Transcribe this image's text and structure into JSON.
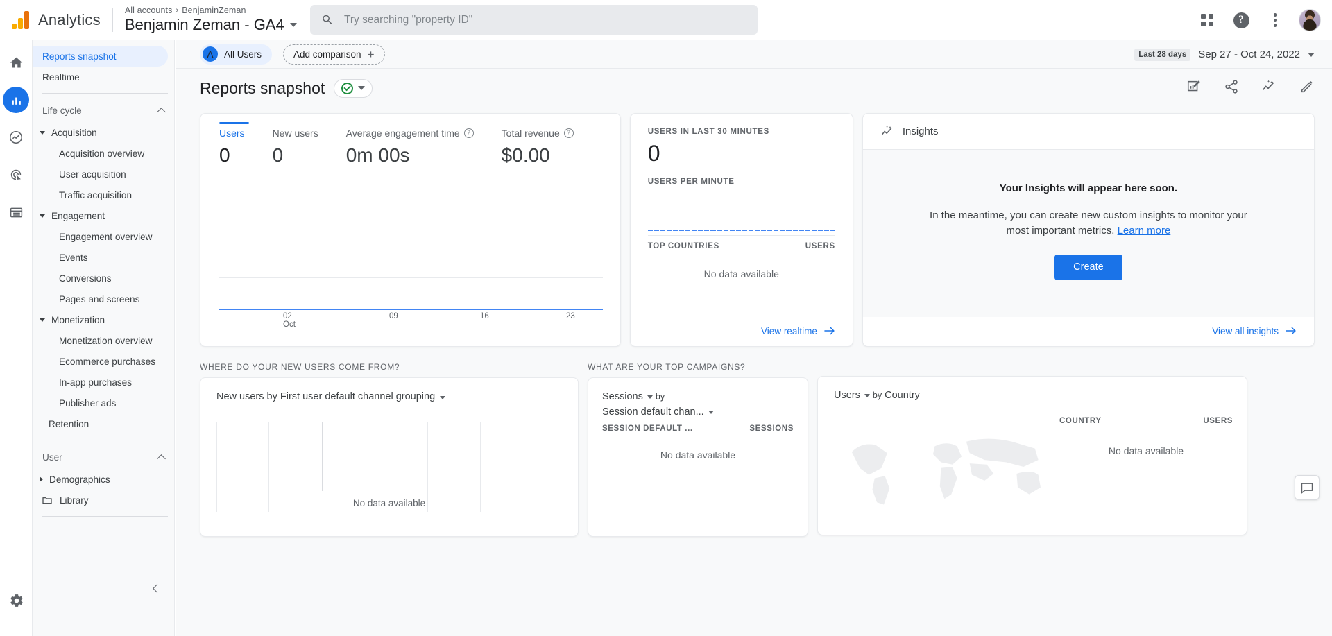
{
  "header": {
    "brand": "Analytics",
    "breadcrumb_root": "All accounts",
    "breadcrumb_sep": "›",
    "breadcrumb_account": "BenjaminZeman",
    "property_name": "Benjamin Zeman - GA4",
    "search_placeholder": "Try searching \"property ID\"",
    "search_value": "",
    "icons": {
      "search": "search-icon",
      "apps": "apps-grid-icon",
      "help": "help-icon",
      "more": "more-vert-icon",
      "avatar": "user-avatar"
    }
  },
  "rail": {
    "items": [
      {
        "name": "home",
        "icon": "home-icon",
        "active": false
      },
      {
        "name": "reports",
        "icon": "bar-chart-icon",
        "active": true
      },
      {
        "name": "explore",
        "icon": "explore-icon",
        "active": false
      },
      {
        "name": "advertising",
        "icon": "advertising-icon",
        "active": false
      },
      {
        "name": "configure",
        "icon": "list-icon",
        "active": false
      }
    ],
    "settings_icon": "gear-icon"
  },
  "sidebar": {
    "top_items": [
      {
        "label": "Reports snapshot",
        "active": true
      },
      {
        "label": "Realtime",
        "active": false
      }
    ],
    "groups": [
      {
        "label": "Life cycle",
        "collapse_icon": "chevron-up-icon",
        "sections": [
          {
            "label": "Acquisition",
            "expanded": true,
            "children": [
              "Acquisition overview",
              "User acquisition",
              "Traffic acquisition"
            ]
          },
          {
            "label": "Engagement",
            "expanded": true,
            "children": [
              "Engagement overview",
              "Events",
              "Conversions",
              "Pages and screens"
            ]
          },
          {
            "label": "Monetization",
            "expanded": true,
            "children": [
              "Monetization overview",
              "Ecommerce purchases",
              "In-app purchases",
              "Publisher ads"
            ]
          }
        ],
        "leaf": "Retention"
      },
      {
        "label": "User",
        "collapse_icon": "chevron-up-icon",
        "sections": [
          {
            "label": "Demographics",
            "expanded": false,
            "children": []
          }
        ],
        "library": "Library"
      }
    ],
    "collapse_label": "collapse-sidebar"
  },
  "toolbar": {
    "all_users_chip": {
      "initial": "A",
      "label": "All Users"
    },
    "add_comparison": "Add comparison",
    "date_badge": "Last 28 days",
    "date_range": "Sep 27 - Oct 24, 2022"
  },
  "page": {
    "title": "Reports snapshot",
    "actions": [
      "edit-report-icon",
      "share-icon",
      "insights-icon",
      "pencil-icon"
    ]
  },
  "overview_card": {
    "metrics": [
      {
        "label": "Users",
        "value": "0",
        "active": true,
        "has_help": false
      },
      {
        "label": "New users",
        "value": "0",
        "active": false,
        "has_help": false
      },
      {
        "label": "Average engagement time",
        "value": "0m 00s",
        "active": false,
        "has_help": true
      },
      {
        "label": "Total revenue",
        "value": "$0.00",
        "active": false,
        "has_help": true
      }
    ]
  },
  "realtime_card": {
    "caption": "USERS IN LAST 30 MINUTES",
    "value": "0",
    "per_minute_caption": "USERS PER MINUTE",
    "table_head": {
      "dimension": "TOP COUNTRIES",
      "metric": "USERS"
    },
    "no_data": "No data available",
    "footer_link": "View realtime",
    "footer_arrow": "arrow-right-icon"
  },
  "insights_card": {
    "title": "Insights",
    "title_icon": "insights-icon",
    "headline": "Your Insights will appear here soon.",
    "body_text": "In the meantime, you can create new custom insights to monitor your most important metrics.",
    "learn_more": "Learn more",
    "create_button": "Create",
    "footer_link": "View all insights",
    "footer_arrow": "arrow-right-icon"
  },
  "bottom_sections": [
    {
      "caption": "WHERE DO YOUR NEW USERS COME FROM?"
    },
    {
      "caption": "WHAT ARE YOUR TOP CAMPAIGNS?"
    }
  ],
  "bottom_cards": {
    "new_users": {
      "title": "New users by First user default channel grouping",
      "dropdown_icon": "chevron-down-icon",
      "no_data": "No data available"
    },
    "campaigns": {
      "metric": "Sessions",
      "by": "by",
      "dimension": "Session default chan...",
      "table_head": {
        "dimension": "SESSION DEFAULT ...",
        "metric": "SESSIONS"
      },
      "no_data": "No data available"
    },
    "countries": {
      "metric": "Users",
      "by": "by",
      "dimension": "Country",
      "table_head": {
        "dimension": "COUNTRY",
        "metric": "USERS"
      },
      "no_data": "No data available"
    }
  },
  "feedback": {
    "icon": "feedback-icon"
  },
  "chart_data": {
    "type": "line",
    "title": "Users over time",
    "x": [
      "02 Oct",
      "09",
      "16",
      "23"
    ],
    "xtick_labels": [
      "02",
      "09",
      "16",
      "23"
    ],
    "xtick_sublabel": "Oct",
    "series": [
      {
        "name": "Users",
        "values": [
          0,
          0,
          0,
          0
        ]
      }
    ],
    "ylim": [
      0,
      1
    ],
    "ylabel": "",
    "xlabel": "",
    "grid": true,
    "legend": "none",
    "line_color": "#4285f4"
  }
}
